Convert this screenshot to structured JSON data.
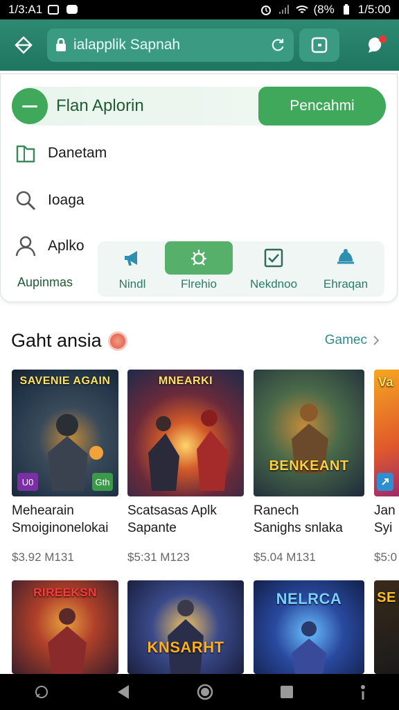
{
  "status_bar": {
    "time": "1/3:A1",
    "battery": "(8%",
    "clock": "1/5:00"
  },
  "header": {
    "url": "ialapplik Sapnah"
  },
  "panel": {
    "plan_title": "Flan Aplorin",
    "plan_button": "Pencahmi",
    "menu": [
      {
        "label": "Danetam",
        "icon": "folder-icon"
      },
      {
        "label": "Ioaga",
        "icon": "search-icon"
      },
      {
        "label": "Aplko",
        "icon": "person-icon"
      }
    ],
    "account_label": "Aupinmas",
    "quick_actions": [
      {
        "label": "Nindl",
        "icon": "megaphone-icon"
      },
      {
        "label": "Flrehio",
        "icon": "bug-icon"
      },
      {
        "label": "Nekdnoo",
        "icon": "checkbox-icon"
      },
      {
        "label": "Ehraqan",
        "icon": "turtle-icon"
      }
    ]
  },
  "section": {
    "title": "Gaht ansia",
    "more_link": "Gamec"
  },
  "games": [
    {
      "thumb_text": "SAVENIE AGAIN",
      "name_line1": "Mehearain",
      "name_line2": "Smoiginonelokai",
      "price": "$3.92 M131",
      "badge_left": "U0",
      "badge_right": "Gth"
    },
    {
      "thumb_text": "MNEARKI",
      "name_line1": "Scatsasas Aplk",
      "name_line2": "Sapante",
      "price": "$5:31 M123"
    },
    {
      "thumb_text": "BENKEANT",
      "name_line1": "Ranech",
      "name_line2": "Sanighs snlaka",
      "price": "$5.04 M131"
    },
    {
      "thumb_text": "Va",
      "name_line1": "Jan",
      "name_line2": "Syi",
      "price": "$5:0"
    },
    {
      "thumb_text": "RIREEKSN"
    },
    {
      "thumb_text": "KNSARHT"
    },
    {
      "thumb_text": "NELRCA"
    },
    {
      "thumb_text": "SE"
    }
  ],
  "colors": {
    "brand": "#1e7560",
    "accent": "#3fa85a",
    "link": "#2e8b90"
  }
}
